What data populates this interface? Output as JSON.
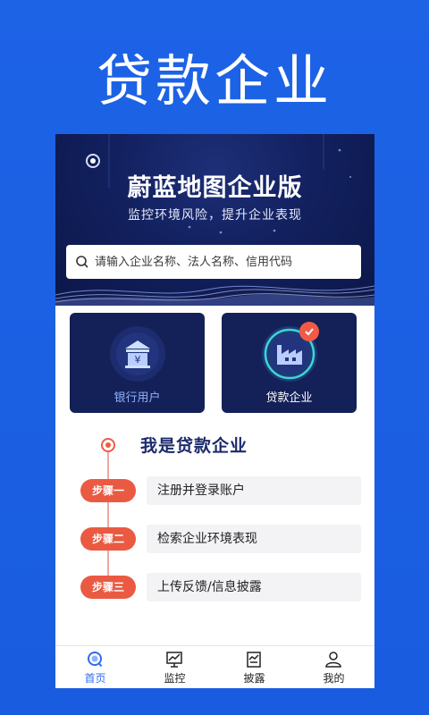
{
  "promo": {
    "title": "贷款企业"
  },
  "hero": {
    "title": "蔚蓝地图企业版",
    "subtitle": "监控环境风险，提升企业表现"
  },
  "search": {
    "placeholder": "请输入企业名称、法人名称、信用代码"
  },
  "cards": [
    {
      "label": "银行用户",
      "icon": "bank-icon"
    },
    {
      "label": "贷款企业",
      "icon": "factory-icon",
      "selected": true
    }
  ],
  "steps": {
    "title": "我是贷款企业",
    "items": [
      {
        "badge": "步骤一",
        "text": "注册并登录账户"
      },
      {
        "badge": "步骤二",
        "text": "检索企业环境表现"
      },
      {
        "badge": "步骤三",
        "text": "上传反馈/信息披露"
      }
    ]
  },
  "tabbar": {
    "items": [
      {
        "label": "首页",
        "icon": "home-icon",
        "active": true
      },
      {
        "label": "监控",
        "icon": "monitor-icon"
      },
      {
        "label": "披露",
        "icon": "disclosure-icon"
      },
      {
        "label": "我的",
        "icon": "user-icon"
      }
    ]
  },
  "colors": {
    "background": "#1d63e6",
    "hero": "#12205e",
    "card": "#142158",
    "accent": "#ea5a42",
    "tab_active": "#2f6cf0"
  }
}
